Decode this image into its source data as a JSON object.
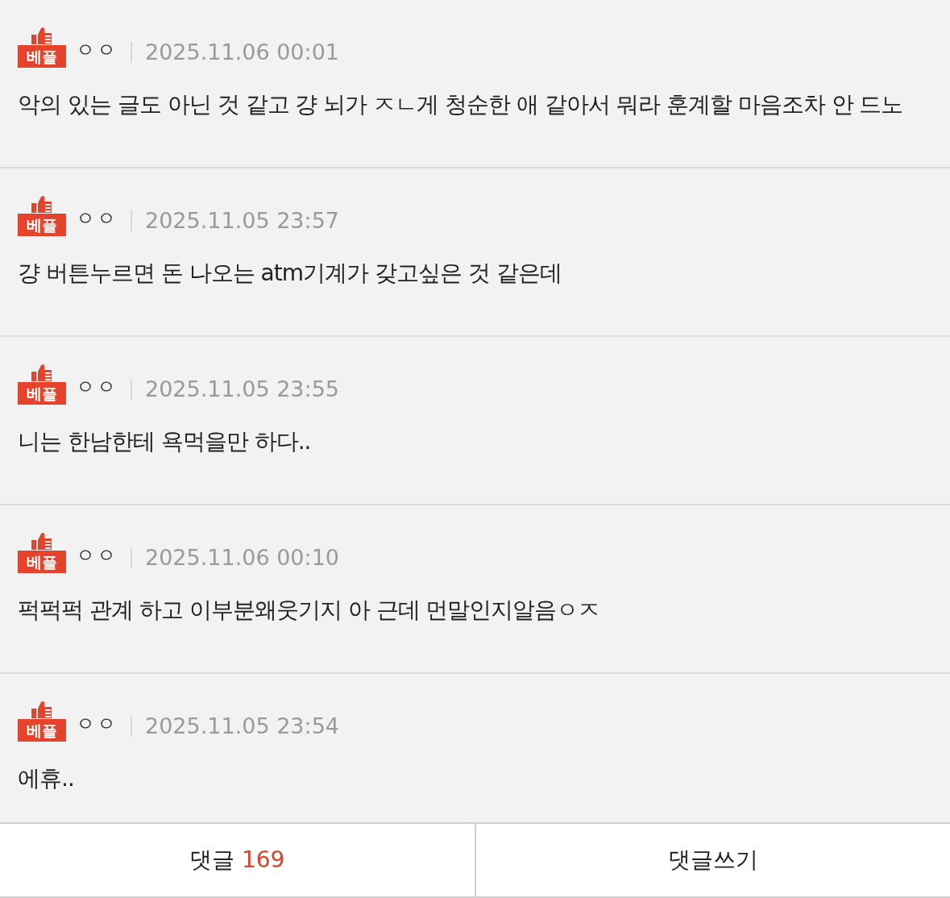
{
  "comments": [
    {
      "badge": "베플",
      "author": "ㅇㅇ",
      "date": "2025.11.06 00:01",
      "text": "악의 있는 글도 아닌 것 같고 걍 뇌가 ㅈㄴ게 청순한 애 같아서 뭐라 훈계할 마음조차 안 드노"
    },
    {
      "badge": "베플",
      "author": "ㅇㅇ",
      "date": "2025.11.05 23:57",
      "text": "걍 버튼누르면 돈 나오는 atm기계가 갖고싶은 것 같은데"
    },
    {
      "badge": "베플",
      "author": "ㅇㅇ",
      "date": "2025.11.05 23:55",
      "text": "니는 한남한테 욕먹을만 하다.."
    },
    {
      "badge": "베플",
      "author": "ㅇㅇ",
      "date": "2025.11.06 00:10",
      "text": "퍽퍽퍽 관계 하고 이부분왜웃기지 아 근데 먼말인지알음ㅇㅈ"
    },
    {
      "badge": "베플",
      "author": "ㅇㅇ",
      "date": "2025.11.05 23:54",
      "text": "에휴.."
    }
  ],
  "bottom_bar": {
    "comments_label": "댓글",
    "comments_count": "169",
    "write_label": "댓글쓰기"
  }
}
